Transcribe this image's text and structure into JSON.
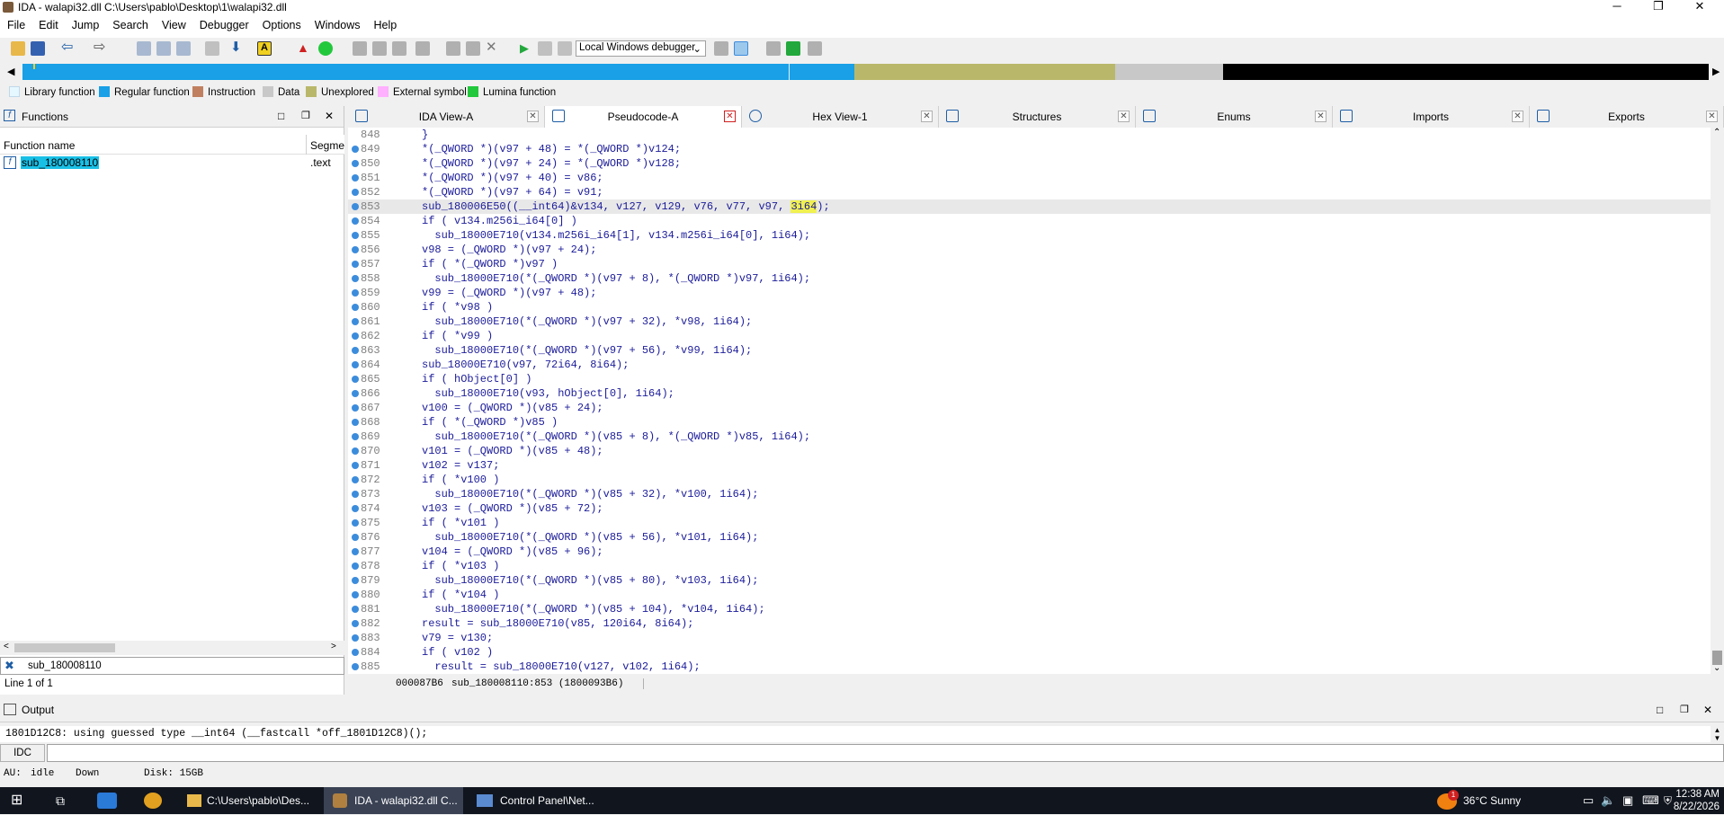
{
  "window": {
    "title": "IDA - walapi32.dll C:\\Users\\pablo\\Desktop\\1\\walapi32.dll",
    "min": "─",
    "max": "❐",
    "close": "✕"
  },
  "menu": [
    "File",
    "Edit",
    "Jump",
    "Search",
    "View",
    "Debugger",
    "Options",
    "Windows",
    "Help"
  ],
  "toolbar": {
    "debugger": "Local Windows debugger"
  },
  "legend": [
    {
      "label": "Library function",
      "color": "#e6f8ff"
    },
    {
      "label": "Regular function",
      "color": "#19a0e6"
    },
    {
      "label": "Instruction",
      "color": "#c08060"
    },
    {
      "label": "Data",
      "color": "#c8c8c8"
    },
    {
      "label": "Unexplored",
      "color": "#b9b86a"
    },
    {
      "label": "External symbol",
      "color": "#ffb0ff"
    },
    {
      "label": "Lumina function",
      "color": "#22c83c"
    }
  ],
  "functions": {
    "title": "Functions",
    "col_name": "Function name",
    "col_seg": "Segme",
    "row_name": "sub_180008110",
    "row_seg": ".text",
    "filter": "sub_180008110",
    "count": "Line 1 of 1"
  },
  "tabs": [
    "IDA View-A",
    "Pseudocode-A",
    "Hex View-1",
    "Structures",
    "Enums",
    "Imports",
    "Exports"
  ],
  "code_lines": [
    {
      "n": "848",
      "t": "}"
    },
    {
      "n": "849",
      "t": "*(_QWORD *)(v97 + 48) = *(_QWORD *)v124;"
    },
    {
      "n": "850",
      "t": "*(_QWORD *)(v97 + 24) = *(_QWORD *)v128;"
    },
    {
      "n": "851",
      "t": "*(_QWORD *)(v97 + 40) = v86;"
    },
    {
      "n": "852",
      "t": "*(_QWORD *)(v97 + 64) = v91;"
    },
    {
      "n": "853",
      "t": "sub_180006E50((__int64)&v134, v127, v129, v76, v77, v97, 3i64);"
    },
    {
      "n": "854",
      "t": "if ( v134.m256i_i64[0] )"
    },
    {
      "n": "855",
      "t": "  sub_18000E710(v134.m256i_i64[1], v134.m256i_i64[0], 1i64);"
    },
    {
      "n": "856",
      "t": "v98 = (_QWORD *)(v97 + 24);"
    },
    {
      "n": "857",
      "t": "if ( *(_QWORD *)v97 )"
    },
    {
      "n": "858",
      "t": "  sub_18000E710(*(_QWORD *)(v97 + 8), *(_QWORD *)v97, 1i64);"
    },
    {
      "n": "859",
      "t": "v99 = (_QWORD *)(v97 + 48);"
    },
    {
      "n": "860",
      "t": "if ( *v98 )"
    },
    {
      "n": "861",
      "t": "  sub_18000E710(*(_QWORD *)(v97 + 32), *v98, 1i64);"
    },
    {
      "n": "862",
      "t": "if ( *v99 )"
    },
    {
      "n": "863",
      "t": "  sub_18000E710(*(_QWORD *)(v97 + 56), *v99, 1i64);"
    },
    {
      "n": "864",
      "t": "sub_18000E710(v97, 72i64, 8i64);"
    },
    {
      "n": "865",
      "t": "if ( hObject[0] )"
    },
    {
      "n": "866",
      "t": "  sub_18000E710(v93, hObject[0], 1i64);"
    },
    {
      "n": "867",
      "t": "v100 = (_QWORD *)(v85 + 24);"
    },
    {
      "n": "868",
      "t": "if ( *(_QWORD *)v85 )"
    },
    {
      "n": "869",
      "t": "  sub_18000E710(*(_QWORD *)(v85 + 8), *(_QWORD *)v85, 1i64);"
    },
    {
      "n": "870",
      "t": "v101 = (_QWORD *)(v85 + 48);"
    },
    {
      "n": "871",
      "t": "v102 = v137;"
    },
    {
      "n": "872",
      "t": "if ( *v100 )"
    },
    {
      "n": "873",
      "t": "  sub_18000E710(*(_QWORD *)(v85 + 32), *v100, 1i64);"
    },
    {
      "n": "874",
      "t": "v103 = (_QWORD *)(v85 + 72);"
    },
    {
      "n": "875",
      "t": "if ( *v101 )"
    },
    {
      "n": "876",
      "t": "  sub_18000E710(*(_QWORD *)(v85 + 56), *v101, 1i64);"
    },
    {
      "n": "877",
      "t": "v104 = (_QWORD *)(v85 + 96);"
    },
    {
      "n": "878",
      "t": "if ( *v103 )"
    },
    {
      "n": "879",
      "t": "  sub_18000E710(*(_QWORD *)(v85 + 80), *v103, 1i64);"
    },
    {
      "n": "880",
      "t": "if ( *v104 )"
    },
    {
      "n": "881",
      "t": "  sub_18000E710(*(_QWORD *)(v85 + 104), *v104, 1i64);"
    },
    {
      "n": "882",
      "t": "result = sub_18000E710(v85, 120i64, 8i64);"
    },
    {
      "n": "883",
      "t": "v79 = v130;"
    },
    {
      "n": "884",
      "t": "if ( v102 )"
    },
    {
      "n": "885",
      "t": "  result = sub_18000E710(v127, v102, 1i64);"
    }
  ],
  "status": {
    "addr": "000087B6",
    "loc": "sub_180008110:853 (1800093B6)"
  },
  "output": {
    "title": "Output",
    "line": "1801D12C8: using guessed type __int64 (__fastcall *off_1801D12C8)();",
    "idc": "IDC",
    "au": "AU:",
    "au_state": "idle",
    "dir": "Down",
    "disk": "Disk: 15GB"
  },
  "taskbar": {
    "explorer": "C:\\Users\\pablo\\Des...",
    "ida": "IDA - walapi32.dll C...",
    "control": "Control Panel\\Net...",
    "weather": "36°C  Sunny",
    "time": "12:38 AM",
    "date": "8/22/2026",
    "badge": "1"
  }
}
